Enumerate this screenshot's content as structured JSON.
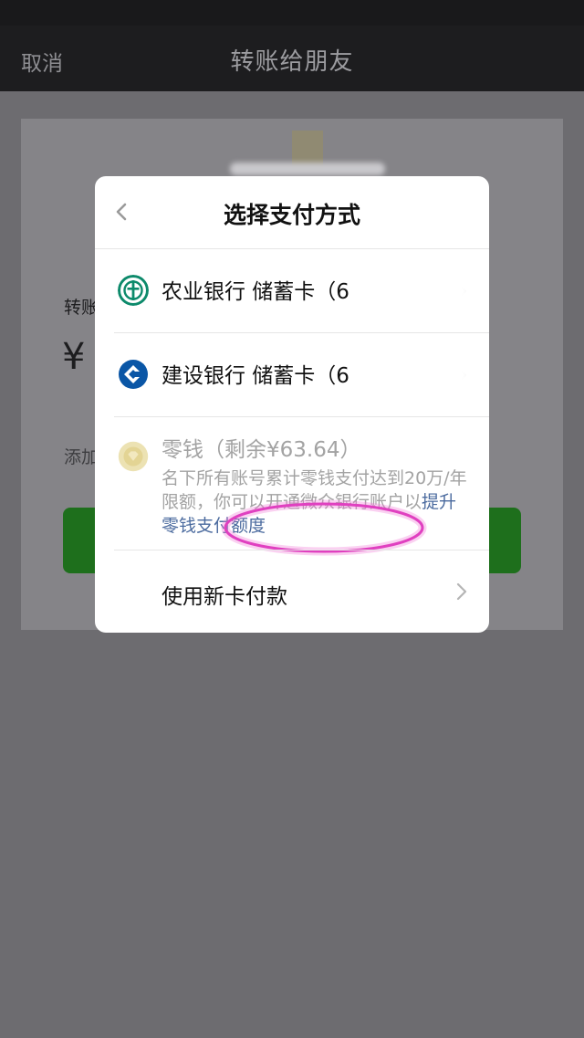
{
  "nav": {
    "cancel": "取消",
    "title": "转账给朋友"
  },
  "background": {
    "amount_label": "转账",
    "currency_symbol": "¥",
    "add_note": "添加"
  },
  "sheet": {
    "title": "选择支付方式",
    "methods": [
      {
        "label": "农业银行 储蓄卡（6",
        "icon": "abc-bank-icon",
        "color": "#0d8a6b"
      },
      {
        "label": "建设银行 储蓄卡（6",
        "icon": "ccb-bank-icon",
        "color": "#0a56a6"
      }
    ],
    "wallet": {
      "label": "零钱（剩余¥63.64）",
      "note_prefix": "名下所有账号累计零钱支付达到20万/年限额，你可以开通微众银行账户以",
      "link": "提升零钱支付额度"
    },
    "new_card": "使用新卡付款"
  },
  "colors": {
    "accent_green": "#1e6f1c",
    "link_blue": "#4a6a9e",
    "annotation_pink": "#e040c0"
  }
}
